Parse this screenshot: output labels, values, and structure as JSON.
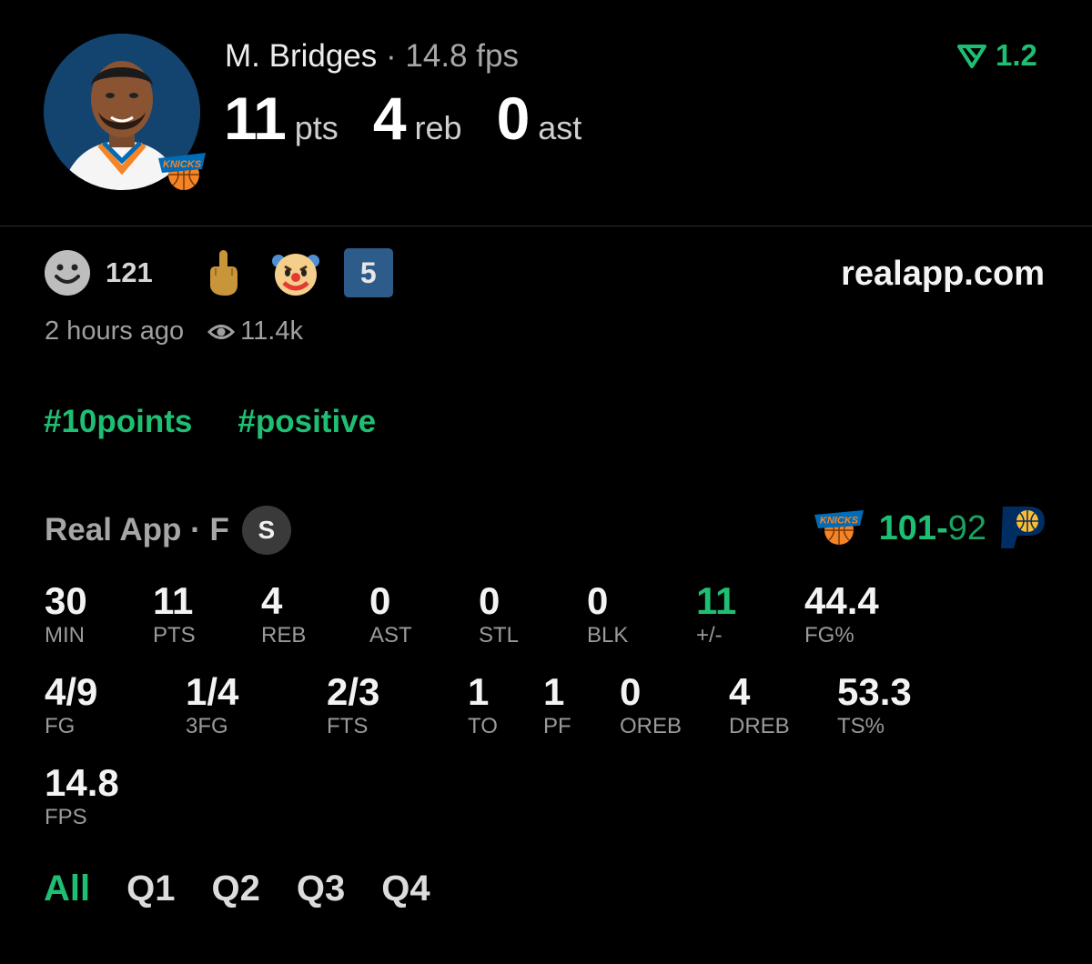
{
  "header": {
    "player_name": "M. Bridges",
    "separator": "·",
    "fps_text": "14.8 fps",
    "points": "11",
    "points_unit": "pts",
    "rebounds": "4",
    "rebounds_unit": "reb",
    "assists": "0",
    "assists_unit": "ast",
    "rating": "1.2",
    "team_badge_text": "KNICKS"
  },
  "reactions": {
    "smile_count": "121",
    "number_badge": "5",
    "site": "realapp.com"
  },
  "meta": {
    "time_ago": "2 hours ago",
    "views": "11.4k"
  },
  "tags": [
    "#10points",
    "#positive"
  ],
  "game": {
    "source": "Real App · F",
    "source_badge": "S",
    "home_score": "101",
    "score_dash": "-",
    "away_score": "92",
    "home_logo_text": "KNICKS"
  },
  "stats": [
    {
      "value": "30",
      "label": "MIN"
    },
    {
      "value": "11",
      "label": "PTS"
    },
    {
      "value": "4",
      "label": "REB"
    },
    {
      "value": "0",
      "label": "AST"
    },
    {
      "value": "0",
      "label": "STL"
    },
    {
      "value": "0",
      "label": "BLK"
    },
    {
      "value": "11",
      "label": "+/-"
    },
    {
      "value": "44.4",
      "label": "FG%"
    },
    {
      "value": "4/9",
      "label": "FG"
    },
    {
      "value": "1/4",
      "label": "3FG"
    },
    {
      "value": "2/3",
      "label": "FTS"
    },
    {
      "value": "1",
      "label": "TO"
    },
    {
      "value": "1",
      "label": "PF"
    },
    {
      "value": "0",
      "label": "OREB"
    },
    {
      "value": "4",
      "label": "DREB"
    },
    {
      "value": "53.3",
      "label": "TS%"
    },
    {
      "value": "14.8",
      "label": "FPS"
    }
  ],
  "quarter_tabs": [
    "All",
    "Q1",
    "Q2",
    "Q3",
    "Q4"
  ],
  "colors": {
    "accent_green": "#1fbf73",
    "background": "#000000",
    "knicks_orange": "#f58426",
    "knicks_blue": "#006bb6",
    "pacers_navy": "#002d62",
    "pacers_gold": "#fdbb30"
  }
}
